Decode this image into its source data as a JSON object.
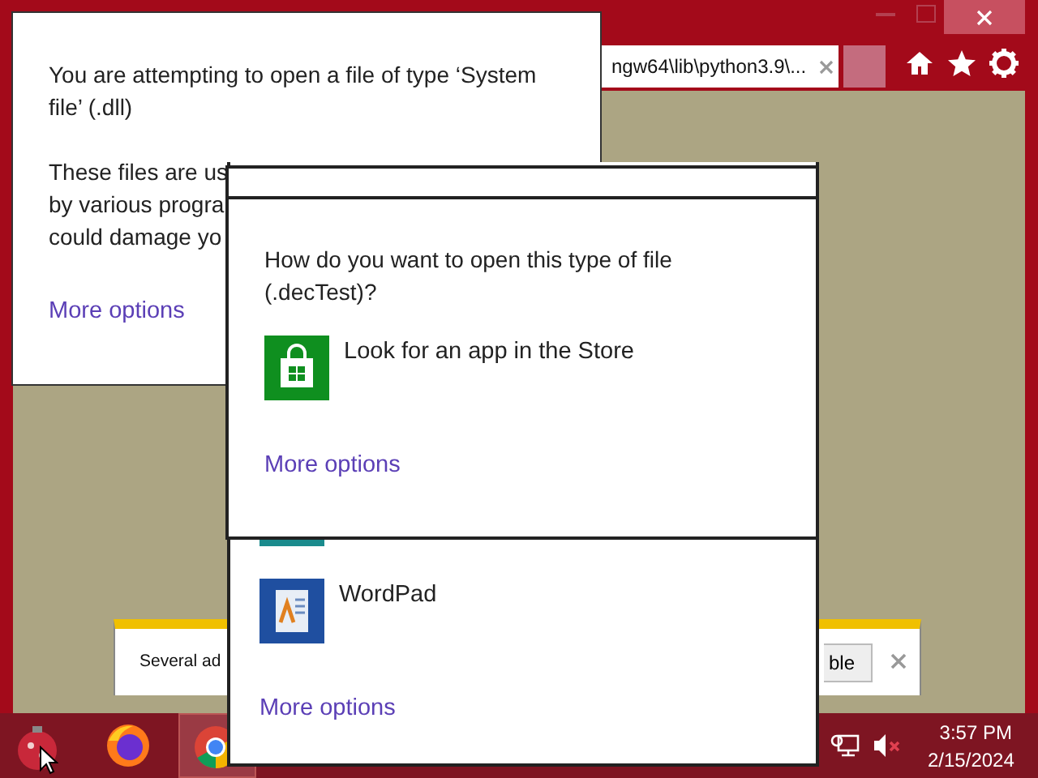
{
  "browser": {
    "tabs": [
      {
        "title": "ngw64\\lib\\python3.9\\...",
        "selected": true
      },
      {
        "selected": false
      }
    ],
    "notification": {
      "text": "Several ad",
      "button": "ble"
    }
  },
  "back_dialog": {
    "message": "You are attempting to open a file of type ‘System file’ (.dll)",
    "body_lines": [
      "These files are us",
      "by various progra",
      "could damage yo"
    ],
    "link": "More options"
  },
  "lower_dialog": {
    "apps": [
      {
        "name": "WordPad",
        "kind": "wordpad"
      }
    ],
    "link": "More options"
  },
  "front_dialog": {
    "question": "How do you want to open this type of file (.decTest)?",
    "apps": [
      {
        "name": "Look for an app in the Store",
        "kind": "store"
      }
    ],
    "link": "More options"
  },
  "taskbar": {
    "time": "3:57 PM",
    "date": "2/15/2024"
  }
}
